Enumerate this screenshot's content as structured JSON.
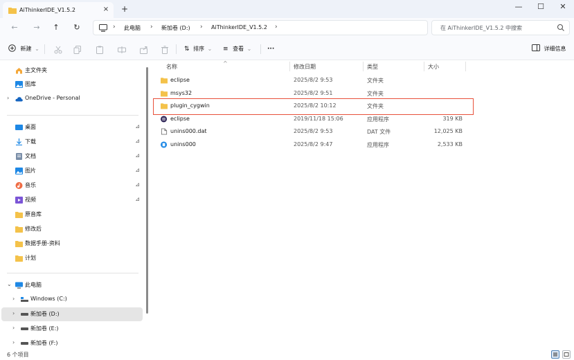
{
  "window": {
    "tab_title": "AiThinkerIDE_V1.5.2",
    "close_tab": "×",
    "new_tab": "+",
    "minimize": "—",
    "maximize": "☐",
    "close": "✕"
  },
  "address": {
    "back": "←",
    "forward": "→",
    "up": "↑",
    "refresh": "↻",
    "sep": "›",
    "crumbs": [
      "此电脑",
      "新加卷 (D:)",
      "AiThinkerIDE_V1.5.2"
    ],
    "search_placeholder": "在 AiThinkerIDE_V1.5.2 中搜索"
  },
  "toolbar": {
    "new_label": "新建",
    "sort_label": "排序",
    "view_label": "查看",
    "more_label": "···",
    "details_label": "详细信息",
    "chev": "⌄"
  },
  "nav": {
    "home": "主文件夹",
    "gallery": "图库",
    "onedrive": "OneDrive - Personal",
    "quick": [
      {
        "label": "桌面",
        "icon": "desktop-icon",
        "color": "#1e88e5"
      },
      {
        "label": "下载",
        "icon": "download-icon",
        "color": "#1e88e5"
      },
      {
        "label": "文档",
        "icon": "document-icon",
        "color": "#7a8ea8"
      },
      {
        "label": "图片",
        "icon": "pictures-icon",
        "color": "#1e88e5"
      },
      {
        "label": "音乐",
        "icon": "music-icon",
        "color": "#ef6c44"
      },
      {
        "label": "视频",
        "icon": "video-icon",
        "color": "#7b55d6"
      },
      {
        "label": "原音库",
        "icon": "folder-icon",
        "color": "#f4c24a"
      },
      {
        "label": "修改后",
        "icon": "folder-icon",
        "color": "#f4c24a"
      },
      {
        "label": "数据手册-资料",
        "icon": "folder-icon",
        "color": "#f4c24a"
      },
      {
        "label": "计划",
        "icon": "folder-icon",
        "color": "#f4c24a"
      }
    ],
    "pin": "⊿",
    "this_pc": "此电脑",
    "drives": [
      {
        "label": "Windows (C:)",
        "selected": false
      },
      {
        "label": "新加卷 (D:)",
        "selected": true
      },
      {
        "label": "新加卷 (E:)",
        "selected": false
      },
      {
        "label": "新加卷 (F:)",
        "selected": false
      }
    ],
    "chev_right": "›",
    "chev_down": "⌄"
  },
  "files": {
    "columns": [
      "名称",
      "修改日期",
      "类型",
      "大小"
    ],
    "sort_arrow": "^",
    "rows": [
      {
        "name": "eclipse",
        "date": "2025/8/2 9:53",
        "type": "文件夹",
        "size": "",
        "icon": "folder-icon"
      },
      {
        "name": "msys32",
        "date": "2025/8/2 9:51",
        "type": "文件夹",
        "size": "",
        "icon": "folder-icon"
      },
      {
        "name": "plugin_cygwin",
        "date": "2025/8/2 10:12",
        "type": "文件夹",
        "size": "",
        "icon": "folder-icon"
      },
      {
        "name": "eclipse",
        "date": "2019/11/18 15:06",
        "type": "应用程序",
        "size": "319 KB",
        "icon": "eclipse-app-icon"
      },
      {
        "name": "unins000.dat",
        "date": "2025/8/2 9:53",
        "type": "DAT 文件",
        "size": "12,025 KB",
        "icon": "file-icon"
      },
      {
        "name": "unins000",
        "date": "2025/8/2 9:47",
        "type": "应用程序",
        "size": "2,533 KB",
        "icon": "installer-app-icon"
      }
    ]
  },
  "status": {
    "count": "6 个项目"
  },
  "colors": {
    "accent": "#1e88e5",
    "folder": "#f4c24a",
    "highlight_box": "#e8503a"
  }
}
